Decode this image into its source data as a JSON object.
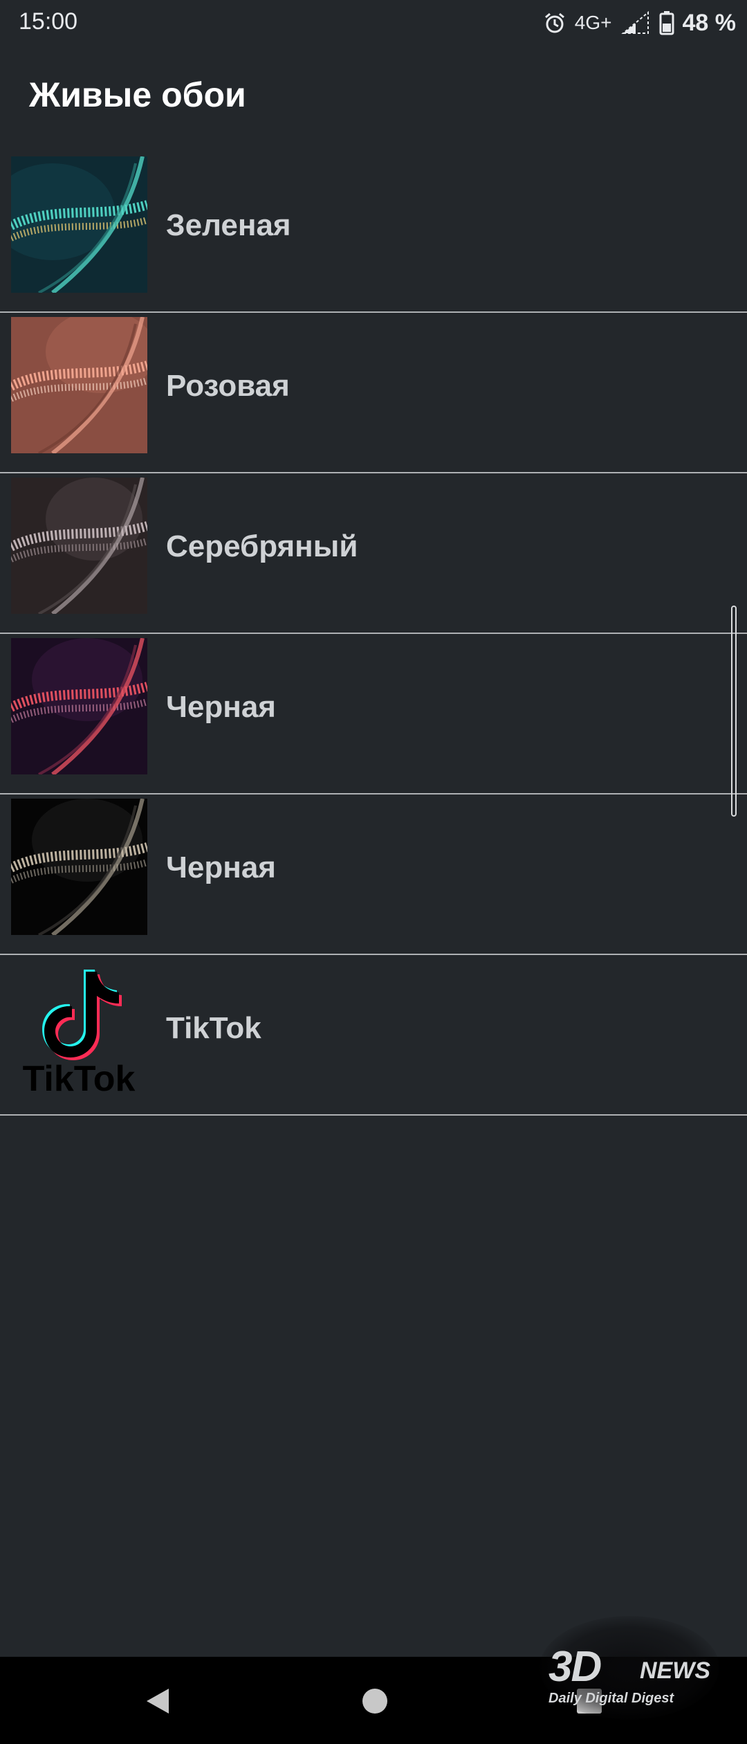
{
  "status_bar": {
    "time": "15:00",
    "network": "4G+",
    "battery_percent": "48 %",
    "icons": [
      "alarm-icon",
      "signal-icon",
      "battery-icon"
    ]
  },
  "page": {
    "title": "Живые обои"
  },
  "wallpapers": [
    {
      "label": "Зеленая",
      "thumbnail": "green-wave-thumbnail",
      "colors": {
        "bg": "#0e2a33",
        "wave": "#4fd1c1",
        "accent": "#c8b46a"
      }
    },
    {
      "label": "Розовая",
      "thumbnail": "pink-wave-thumbnail",
      "colors": {
        "bg": "#8a4e42",
        "wave": "#f0a48e",
        "accent": "#e8c0b0"
      }
    },
    {
      "label": "Серебряный",
      "thumbnail": "silver-wave-thumbnail",
      "colors": {
        "bg": "#2a2324",
        "wave": "#bfb2b5",
        "accent": "#7c6f72"
      }
    },
    {
      "label": "Черная",
      "thumbnail": "black-red-wave-thumbnail",
      "colors": {
        "bg": "#1b0d22",
        "wave": "#e0505f",
        "accent": "#b07090"
      }
    },
    {
      "label": "Черная",
      "thumbnail": "black-gold-wave-thumbnail",
      "colors": {
        "bg": "#050505",
        "wave": "#bdb2a0",
        "accent": "#6b665e"
      }
    },
    {
      "label": "TikTok",
      "thumbnail": "tiktok-logo",
      "logo_text": "TikTok",
      "colors": {
        "bg": "#23272b",
        "wave": "#fe2c55",
        "accent": "#25f4ee"
      }
    }
  ],
  "watermark": {
    "logo": "3D",
    "news": "NEWS",
    "tagline": "Daily Digital Digest"
  },
  "nav_bar": {
    "icons": [
      "back-icon",
      "home-icon",
      "recents-icon"
    ]
  },
  "theme": {
    "background": "#23272b",
    "divider": "#aeb1b4",
    "title_color": "#ffffff",
    "label_color": "#cfd2d5"
  }
}
